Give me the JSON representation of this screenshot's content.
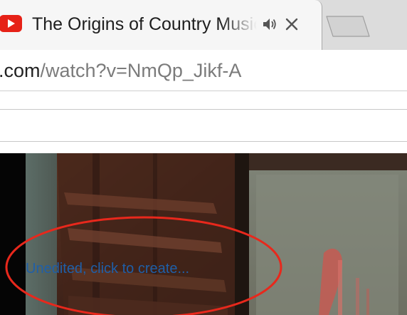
{
  "tab": {
    "title": "The Origins of Country Music",
    "favicon": "youtube-icon",
    "audio_icon": "speaker-icon",
    "close_icon": "close-icon"
  },
  "address_bar": {
    "host_part": ".com",
    "path_part": "/watch?v=NmQp_Jikf-A"
  },
  "video": {
    "caption_link": "Unedited, click to create..."
  },
  "colors": {
    "youtube_red": "#e62117",
    "caption_blue": "#1f5fa8",
    "annotation_red": "#e8281c"
  }
}
